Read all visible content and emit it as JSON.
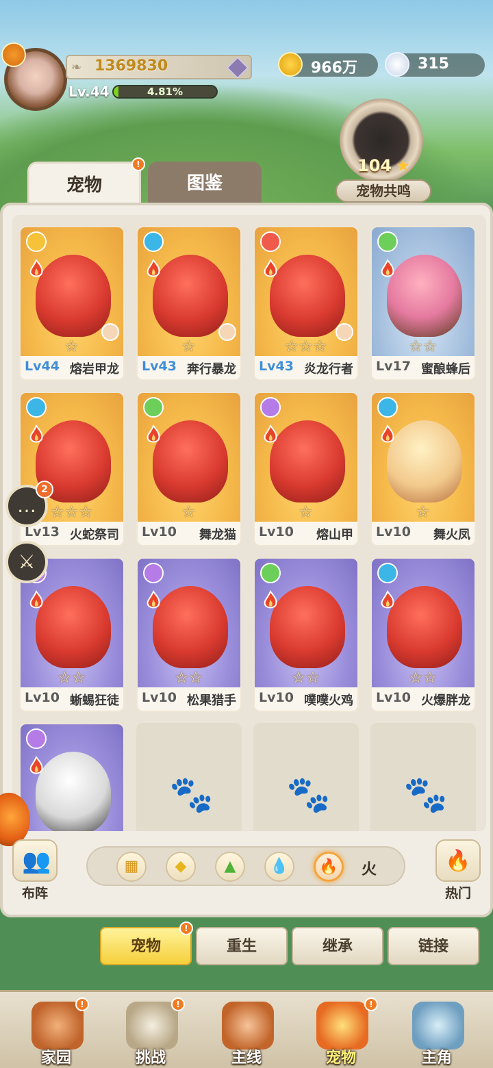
{
  "header": {
    "power": "1369830",
    "level": "Lv.44",
    "exp_percent": "4.81%",
    "exp_fraction": 0.0481,
    "coins": "966万",
    "shells": "315",
    "resonance_value": "104",
    "resonance_label": "宠物共鸣"
  },
  "tabs": [
    {
      "label": "宠物",
      "active": true,
      "badge": "!"
    },
    {
      "label": "图鉴",
      "active": false
    }
  ],
  "pets": [
    {
      "level": "Lv44",
      "name": "熔岩甲龙",
      "stars": "☆",
      "type": "shield",
      "art": "orange",
      "highlight": true
    },
    {
      "level": "Lv43",
      "name": "奔行暴龙",
      "stars": "☆",
      "type": "key",
      "art": "orange",
      "highlight": true
    },
    {
      "level": "Lv43",
      "name": "炎龙行者",
      "stars": "☆☆☆",
      "type": "fist",
      "art": "orange",
      "highlight": true
    },
    {
      "level": "Lv17",
      "name": "蜜酿蜂后",
      "stars": "☆☆",
      "type": "heart",
      "art": "blue",
      "highlight": false
    },
    {
      "level": "Lv13",
      "name": "火蛇祭司",
      "stars": "☆☆☆",
      "type": "key",
      "art": "orange",
      "highlight": false
    },
    {
      "level": "Lv10",
      "name": "舞龙猫",
      "stars": "☆",
      "type": "heart",
      "art": "orange",
      "highlight": false
    },
    {
      "level": "Lv10",
      "name": "熔山甲",
      "stars": "☆",
      "type": "swirl",
      "art": "orange",
      "highlight": false
    },
    {
      "level": "Lv10",
      "name": "舞火凤",
      "stars": "☆",
      "type": "key",
      "art": "orange",
      "highlight": false
    },
    {
      "level": "Lv10",
      "name": "蜥蜴狂徒",
      "stars": "☆☆",
      "type": "swirl",
      "art": "purple",
      "highlight": false
    },
    {
      "level": "Lv10",
      "name": "松果猎手",
      "stars": "☆☆",
      "type": "swirl",
      "art": "purple",
      "highlight": false
    },
    {
      "level": "Lv10",
      "name": "噗噗火鸡",
      "stars": "☆☆",
      "type": "heart",
      "art": "purple",
      "highlight": false
    },
    {
      "level": "Lv10",
      "name": "火爆胖龙",
      "stars": "☆☆",
      "type": "key",
      "art": "purple",
      "highlight": false
    }
  ],
  "side": {
    "chat_badge": "2"
  },
  "filter": {
    "formation_label": "布阵",
    "selected_label": "火",
    "hot_label": "热门"
  },
  "subtabs": [
    "宠物",
    "重生",
    "继承",
    "链接"
  ],
  "nav": [
    "家园",
    "挑战",
    "主线",
    "宠物",
    "主角"
  ],
  "colors": {
    "accent": "#f07b23",
    "active_level": "#3f8ed8",
    "exp": "#7ed321"
  }
}
